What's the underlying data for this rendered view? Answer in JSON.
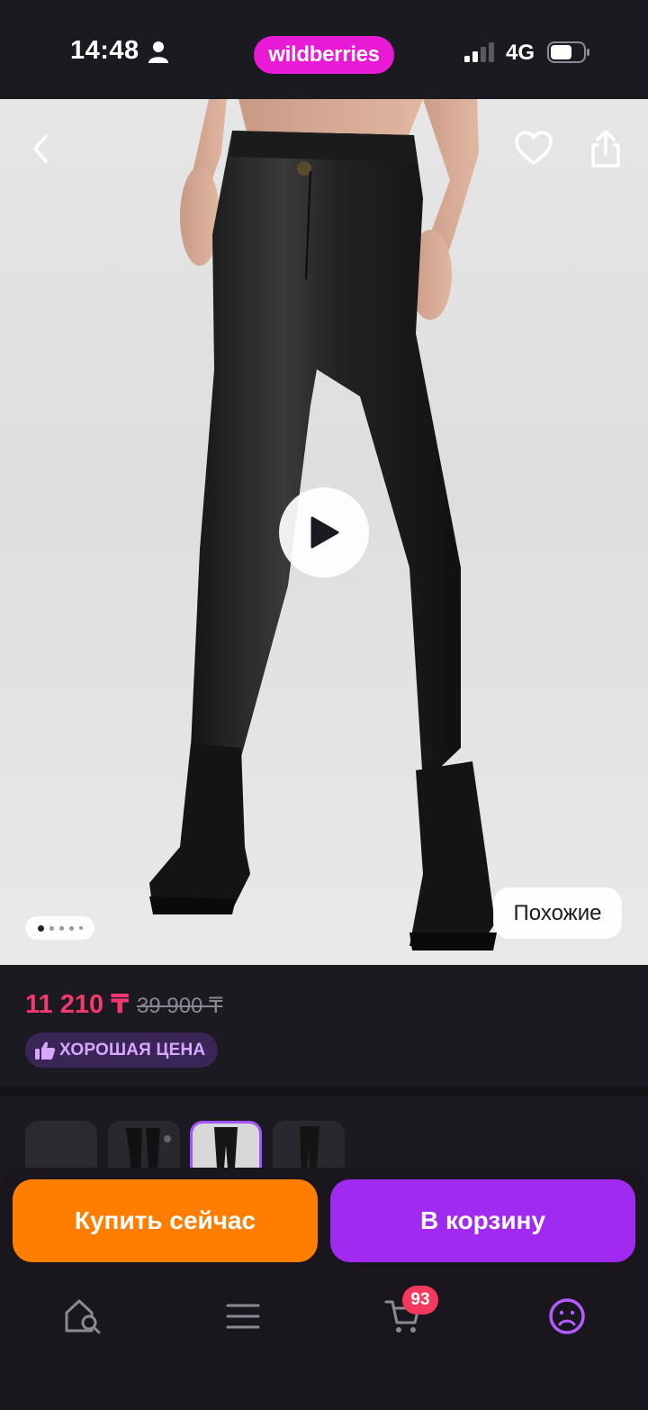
{
  "status_bar": {
    "time": "14:48",
    "network": "4G",
    "brand": "wildberries",
    "icons": [
      "person-icon",
      "signal-icon",
      "battery-icon"
    ]
  },
  "hero": {
    "icons": [
      "back-icon",
      "heart-icon",
      "share-icon",
      "play-icon"
    ],
    "similar_label": "Похожие",
    "gallery_page": 1,
    "gallery_count": 5
  },
  "price": {
    "current": "11 210 ₸",
    "old": "39 900 ₸",
    "badge_icon": "thumbs-up-icon",
    "badge_label": "ХОРОШАЯ ЦЕНА"
  },
  "variants": {
    "selected_index": 2,
    "count": 4
  },
  "actions": {
    "buy_now_label": "Купить сейчас",
    "add_to_cart_label": "В корзину"
  },
  "tab_bar": {
    "tabs": [
      {
        "icon": "home-search-icon"
      },
      {
        "icon": "menu-icon"
      },
      {
        "icon": "cart-icon"
      },
      {
        "icon": "profile-icon"
      }
    ],
    "cart_count": "93",
    "active_tab": "profile-icon"
  },
  "colors": {
    "brand": "#e81ad6",
    "price": "#f5386e",
    "buy_now": "#ff7e00",
    "add_to_cart": "#a12af0",
    "badge_text": "#d8a8ff",
    "active_tab": "#b45cff"
  }
}
